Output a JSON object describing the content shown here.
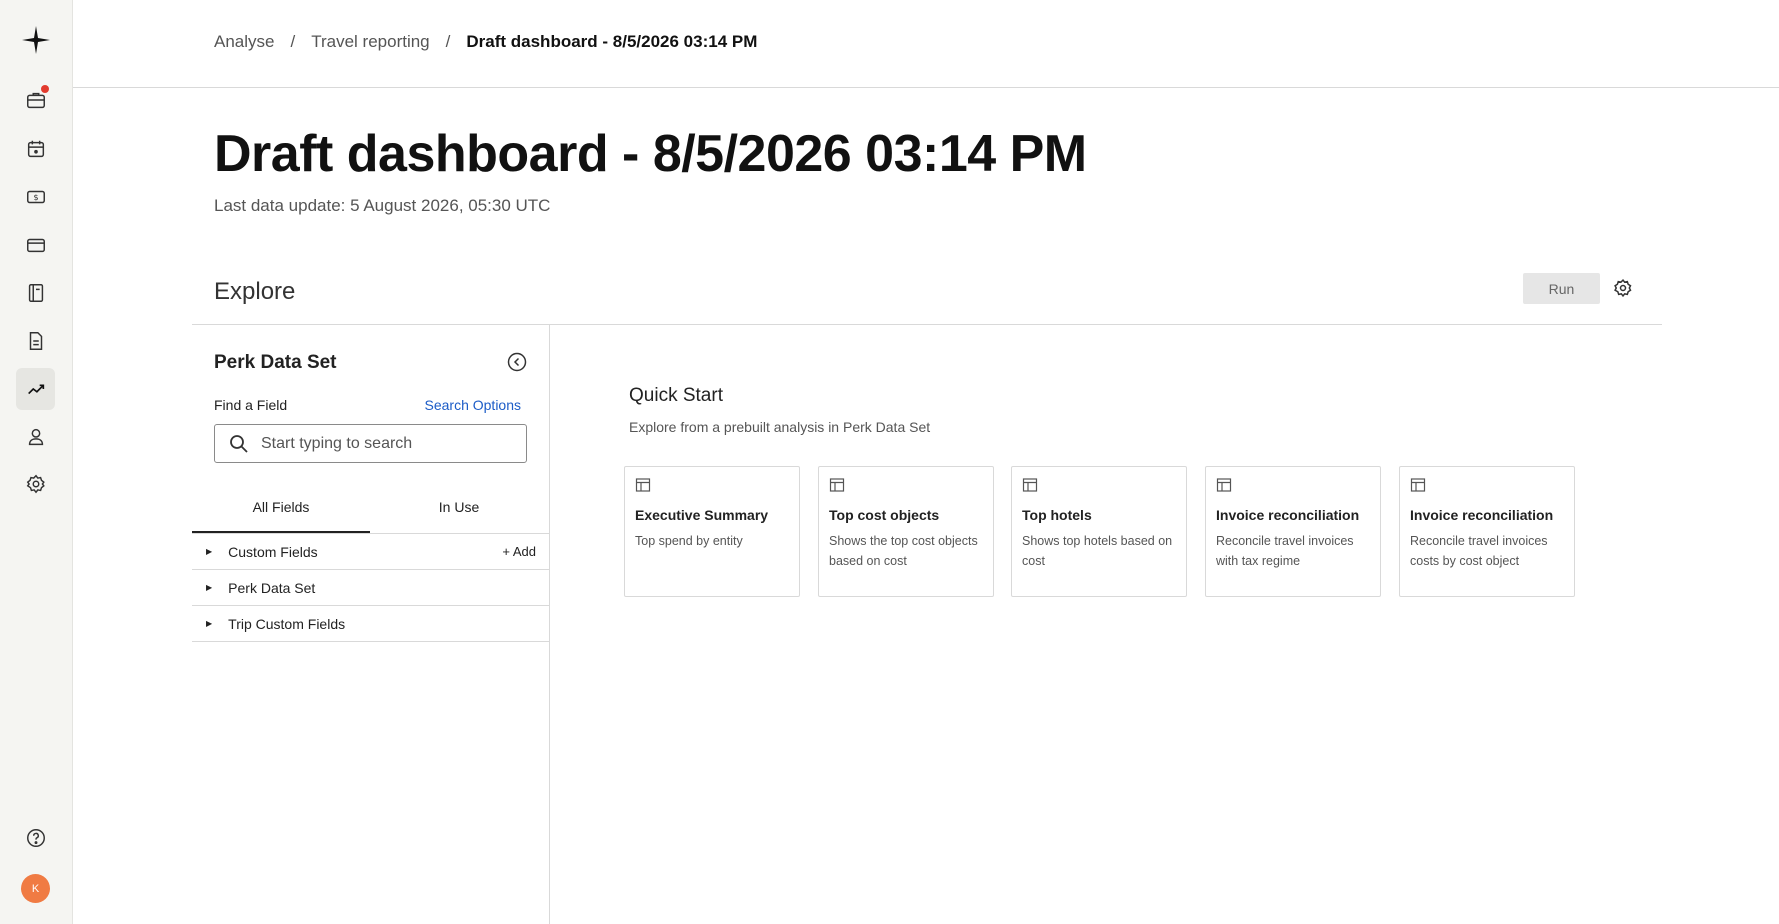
{
  "breadcrumb": {
    "items": [
      "Analyse",
      "Travel reporting"
    ],
    "current": "Draft dashboard - 8/5/2026 03:14 PM"
  },
  "page": {
    "title": "Draft dashboard - 8/5/2026 03:14 PM",
    "last_update": "Last data update: 5 August 2026, 05:30 UTC"
  },
  "explore": {
    "label": "Explore",
    "run_label": "Run"
  },
  "panel": {
    "title": "Perk Data Set",
    "find_label": "Find a Field",
    "search_options": "Search Options",
    "search_placeholder": "Start typing to search",
    "tabs": [
      {
        "label": "All Fields",
        "active": true
      },
      {
        "label": "In Use",
        "active": false
      }
    ],
    "rows": [
      {
        "label": "Custom Fields",
        "action": "Add"
      },
      {
        "label": "Perk Data Set"
      },
      {
        "label": "Trip Custom Fields"
      }
    ]
  },
  "quick_start": {
    "title": "Quick Start",
    "subtitle": "Explore from a prebuilt analysis in Perk Data Set",
    "cards": [
      {
        "title": "Executive Summary",
        "description": "Top spend by entity"
      },
      {
        "title": "Top cost objects",
        "description": "Shows the top cost objects based on cost"
      },
      {
        "title": "Top hotels",
        "description": "Shows top hotels based on cost"
      },
      {
        "title": "Invoice reconciliation",
        "description": "Reconcile travel invoices with tax regime"
      },
      {
        "title": "Invoice reconciliation",
        "description": "Reconcile travel invoices costs by cost object"
      }
    ]
  },
  "rail": {
    "avatar_initial": "K",
    "icons": [
      "logo-icon",
      "briefcase-icon",
      "calendar-icon",
      "money-icon",
      "card-icon",
      "book-icon",
      "document-icon",
      "chart-icon",
      "user-icon",
      "settings-icon",
      "help-icon"
    ]
  },
  "colors": {
    "accent_link": "#1c5cc7",
    "notification": "#e23b2e",
    "avatar": "#f07b43"
  }
}
